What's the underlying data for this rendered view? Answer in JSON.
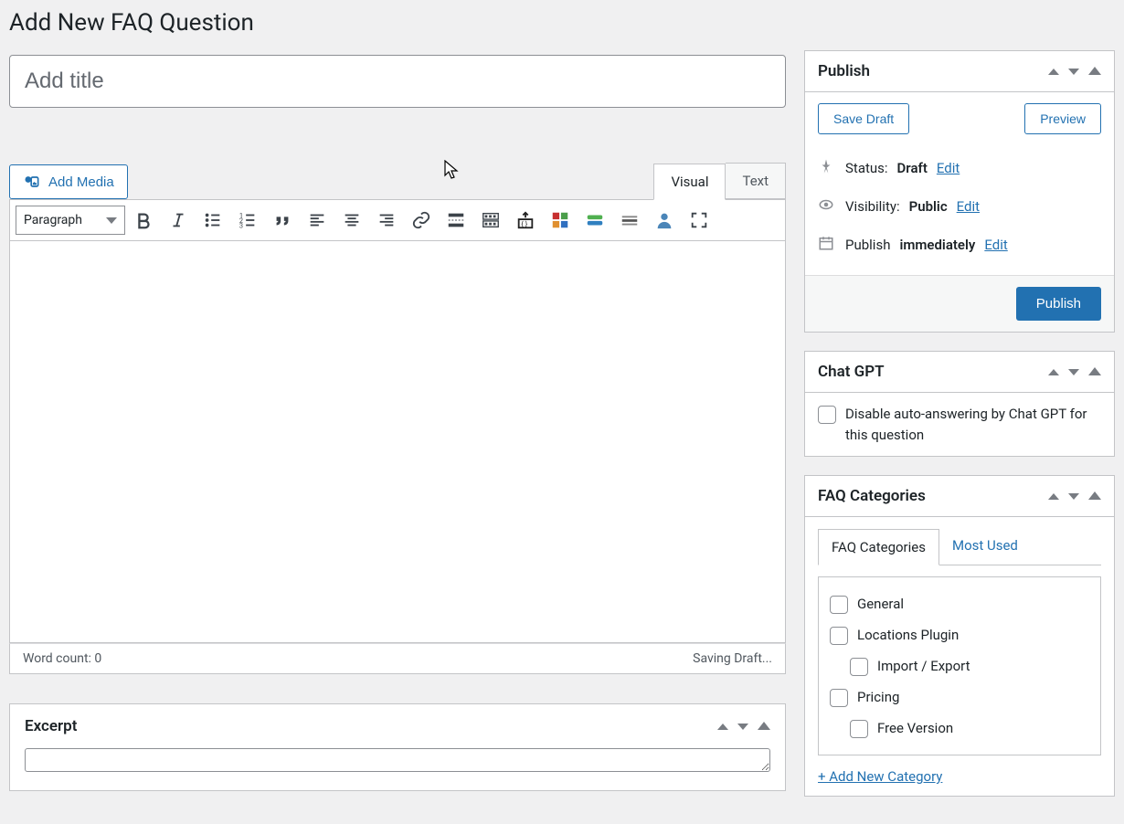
{
  "page": {
    "heading": "Add New FAQ Question",
    "title_placeholder": "Add title"
  },
  "editor": {
    "add_media": "Add Media",
    "tabs": {
      "visual": "Visual",
      "text": "Text"
    },
    "format_select": "Paragraph",
    "word_count_label": "Word count: 0",
    "saving_status": "Saving Draft...",
    "toolbar_icons": [
      "bold",
      "italic",
      "ul",
      "ol",
      "blockquote",
      "align-left",
      "align-center",
      "align-right",
      "link",
      "read-more",
      "toolbar-toggle",
      "code-block",
      "shortcodes",
      "columns",
      "hr",
      "user",
      "fullscreen"
    ]
  },
  "publish": {
    "title": "Publish",
    "save_draft": "Save Draft",
    "preview": "Preview",
    "status_label": "Status:",
    "status_value": "Draft",
    "visibility_label": "Visibility:",
    "visibility_value": "Public",
    "schedule_label": "Publish",
    "schedule_value": "immediately",
    "edit": "Edit",
    "publish_btn": "Publish"
  },
  "chatgpt": {
    "title": "Chat GPT",
    "checkbox_label": "Disable auto-answering by Chat GPT for this question"
  },
  "categories": {
    "title": "FAQ Categories",
    "tabs": {
      "all": "FAQ Categories",
      "most_used": "Most Used"
    },
    "items": [
      {
        "label": "General",
        "indent": false
      },
      {
        "label": "Locations Plugin",
        "indent": false
      },
      {
        "label": "Import / Export",
        "indent": true
      },
      {
        "label": "Pricing",
        "indent": false
      },
      {
        "label": "Free Version",
        "indent": true
      }
    ],
    "add_new": "+ Add New Category"
  },
  "excerpt": {
    "title": "Excerpt"
  }
}
